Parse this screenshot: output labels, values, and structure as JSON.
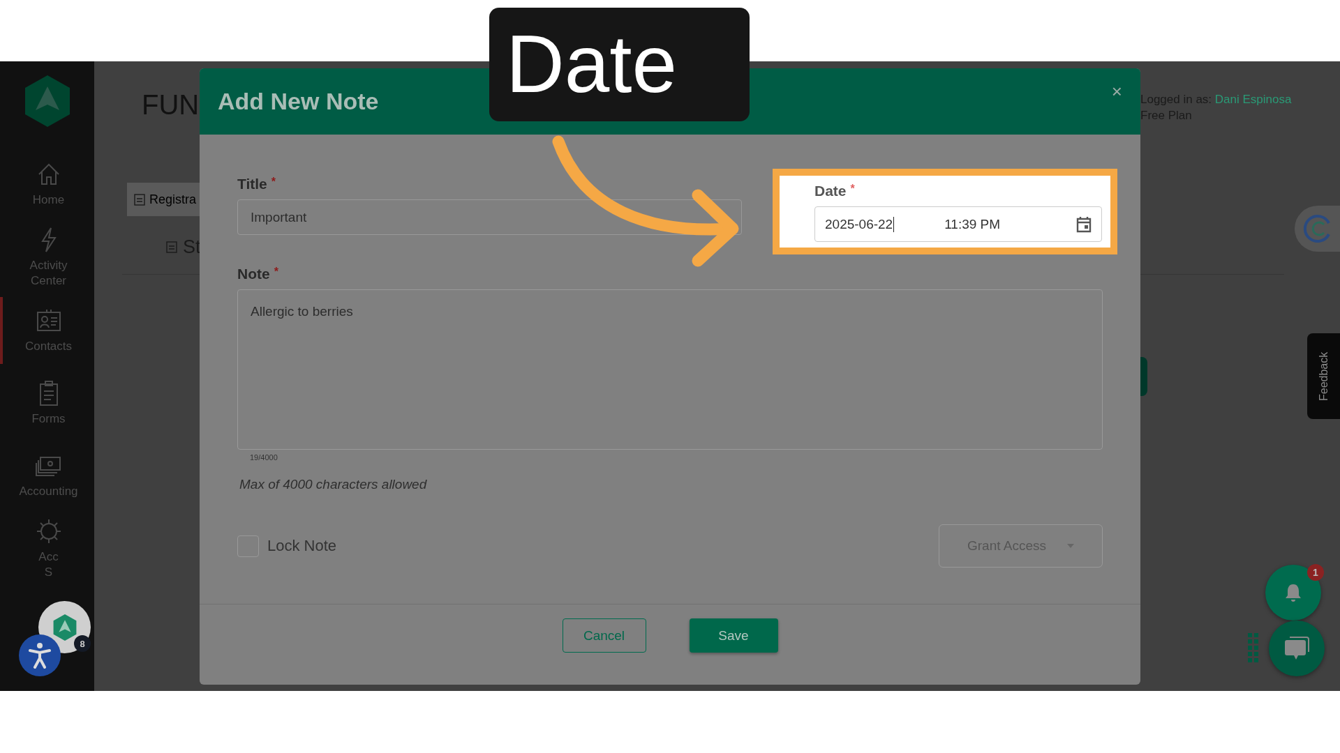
{
  "tutorial_caption": "Date",
  "sidebar": {
    "items": [
      {
        "label": "Home",
        "selected": false
      },
      {
        "label": "Activity Center",
        "selected": false
      },
      {
        "label": "Contacts",
        "selected": true
      },
      {
        "label": "Forms",
        "selected": false
      },
      {
        "label": "Accounting",
        "selected": false
      },
      {
        "label": "Acc\nS",
        "selected": false
      }
    ]
  },
  "page": {
    "heading": "FUN",
    "tabs": [
      {
        "label": "Registra",
        "selected": true
      },
      {
        "label": "St",
        "selected": false
      }
    ],
    "account": {
      "prefix": "Logged in as:",
      "user": "Dani Espinosa",
      "plan": "Free Plan"
    },
    "feedback": "Feedback"
  },
  "modal": {
    "title": "Add New Note",
    "close": "×",
    "title_field": {
      "label": "Title",
      "required_mark": "*",
      "value": "Important"
    },
    "date_field": {
      "label": "Date",
      "required_mark": "*",
      "date": "2025-06-22",
      "time": "11:39 PM"
    },
    "note_field": {
      "label": "Note",
      "required_mark": "*",
      "value": "Allergic to berries",
      "counter": "19/4000",
      "hint": "Max of 4000 characters allowed"
    },
    "lock": {
      "label": "Lock Note",
      "checked": false
    },
    "grant_access": {
      "label": "Grant Access"
    },
    "buttons": {
      "cancel": "Cancel",
      "save": "Save"
    }
  },
  "floating": {
    "notification_count": "1",
    "widget_count": "8"
  }
}
